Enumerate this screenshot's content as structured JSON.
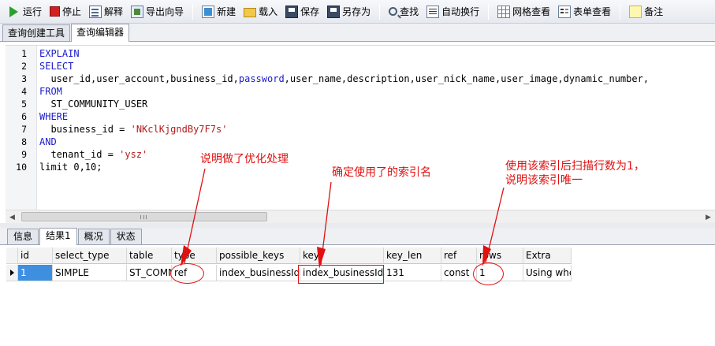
{
  "toolbar": {
    "run": "运行",
    "stop": "停止",
    "explain": "解释",
    "export_wizard": "导出向导",
    "new": "新建",
    "load": "载入",
    "save": "保存",
    "save_as": "另存为",
    "find": "查找",
    "word_wrap": "自动换行",
    "grid_view": "网格查看",
    "form_view": "表单查看",
    "memo": "备注"
  },
  "tabs": [
    {
      "label": "查询创建工具"
    },
    {
      "label": "查询编辑器"
    }
  ],
  "editor": {
    "line_numbers": [
      "1",
      "2",
      "3",
      "4",
      "5",
      "6",
      "7",
      "8",
      "9",
      "10"
    ],
    "lines": [
      "EXPLAIN",
      "SELECT",
      "  user_id,user_account,business_id,password,user_name,description,user_nick_name,user_image,dynamic_number,",
      "FROM",
      "  ST_COMMUNITY_USER",
      "WHERE",
      "  business_id = 'NKclKjgndBy7F7s'",
      "AND",
      "  tenant_id = 'ysz'",
      "limit 0,10;"
    ],
    "code": {
      "l1": "EXPLAIN",
      "l2": "SELECT",
      "l3_pre": "  user_id,user_account,business_id,",
      "l3_kw": "password",
      "l3_post": ",user_name,description,user_nick_name,user_image,dynamic_number,",
      "l4": "FROM",
      "l5": "  ST_COMMUNITY_USER",
      "l6": "WHERE",
      "l7_pre": "  business_id = ",
      "l7_str": "'NKclKjgndBy7F7s'",
      "l8": "AND",
      "l9_pre": "  tenant_id = ",
      "l9_str": "'ysz'",
      "l10": "limit 0,10;"
    }
  },
  "result_tabs": [
    {
      "label": "信息"
    },
    {
      "label": "结果1"
    },
    {
      "label": "概况"
    },
    {
      "label": "状态"
    }
  ],
  "result": {
    "columns": [
      "id",
      "select_type",
      "table",
      "type",
      "possible_keys",
      "key",
      "key_len",
      "ref",
      "rows",
      "Extra"
    ],
    "row": [
      "1",
      "SIMPLE",
      "ST_COMMUNITY_USER",
      "ref",
      "index_businessId",
      "index_businessId",
      "131",
      "const",
      "1",
      "Using where"
    ]
  },
  "annotations": {
    "note1": "说明做了优化处理",
    "note2": "确定使用了的索引名",
    "note3_line1": "使用该索引后扫描行数为1，",
    "note3_line2": "说明该索引唯一"
  },
  "colors": {
    "keyword": "#1b1bcc",
    "string": "#b51a1a",
    "annotation": "#e01010",
    "selected_cell": "#3f8fe0"
  }
}
